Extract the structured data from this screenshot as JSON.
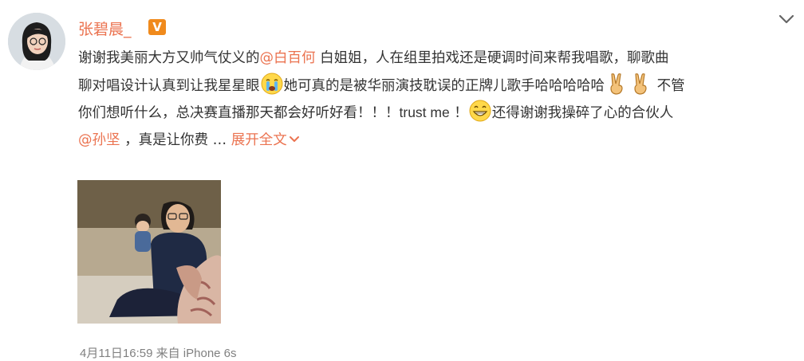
{
  "post": {
    "author": "张碧晨_",
    "verified_badge": "V",
    "text": {
      "line1_a": "谢谢我美丽大方又帅气仗义的",
      "mention_bai": "@白百何",
      "line1_b": " 白姐姐，人在组里拍戏还是硬调时间来帮我唱歌，聊歌曲",
      "line2_a": "聊对唱设计认真到让我星星眼",
      "line2_b": "她可真的是被华丽演技耽误的正牌儿歌手哈哈哈哈哈",
      "line2_c": " 不管",
      "line3_a": "你们想听什么，总决赛直播那天都会好听好看！！！",
      "line3_b": "trust me",
      "line3_c": " ！",
      "line3_d": "还得谢谢我操碎了心的合伙人",
      "mention_sun": "@孙坚",
      "line4_b": " ，真是让你费 … ",
      "expand_label": "展开全文"
    },
    "icons": {
      "emoji_1": "crying-face-icon",
      "emoji_2": "victory-hand-icon",
      "emoji_3": "grinning-face-icon",
      "menu": "chevron-down-icon"
    },
    "time": "4月11日16:59",
    "source": "来自 iPhone 6s"
  },
  "colors": {
    "accent": "#eb7350",
    "text": "#333333",
    "meta": "#808080",
    "badge": "#f08a1c"
  }
}
